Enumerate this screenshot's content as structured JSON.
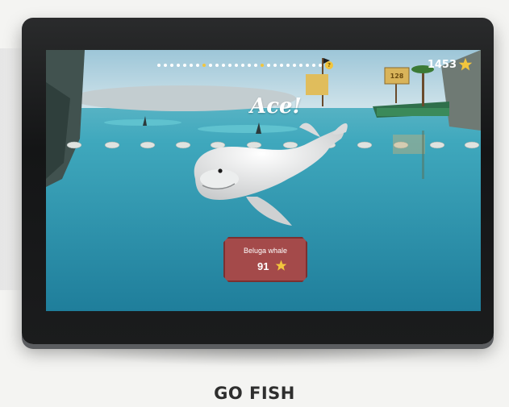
{
  "game": {
    "title_text": "GO FISH",
    "score": "1453",
    "feedback": "Ace!",
    "catch": {
      "name": "Beluga whale",
      "points": "91"
    },
    "sign_text": "128",
    "progress": {
      "total_dots": 26,
      "gold_dot_indices": [
        7,
        16
      ],
      "end_marker": "?"
    }
  },
  "colors": {
    "star": "#f2c53d",
    "card": "#a44a4a",
    "water": "#2f9fb8"
  },
  "icons": {
    "score_icon": "star-icon",
    "card_icon": "star-icon"
  }
}
